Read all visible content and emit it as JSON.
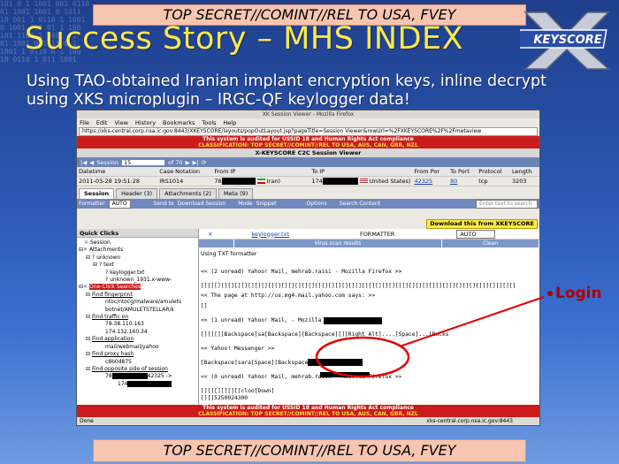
{
  "classification_banner": "TOP SECRET//COMINT//REL TO USA, FVEY",
  "title": "Success Story – MHS INDEX",
  "logo_text": "KEYSCORE",
  "subtitle": "Using TAO-obtained Iranian implant encryption keys, inline decrypt using XKS microplugin – IRGC-QF keylogger data!",
  "annotation_label": "Login",
  "browser": {
    "window_title": "XK Session Viewer - Mozilla Firefox",
    "menu": [
      "File",
      "Edit",
      "View",
      "History",
      "Bookmarks",
      "Tools",
      "Help"
    ],
    "url": "https://xks-central.corp.nsa.ic.gov:8443/XKEYSCORE/layouts/popOutLayout.jsp?pageTitle=Session Viewer&rowUrl=%2FXKEYSCORE%2F%2Fmetaview",
    "audit_line1": "This system is audited for USSID 18 and Human Rights Act compliance",
    "audit_line2": "CLASSIFICATION: TOP SECRET//COMINT//REL TO USA, AUS, CAN, GBR, NZL",
    "viewer_title": "X-KEYSCORE C2C Session Viewer",
    "session_label": "Session",
    "session_value": "15",
    "session_of": "of 70",
    "meta_headers": [
      "Datetime",
      "Case Notation",
      "From IP",
      "To IP",
      "From Por",
      "To Port",
      "Protocol",
      "Length"
    ],
    "meta_row": {
      "datetime": "2011-03-28 19:51:28",
      "case": "IRS1014",
      "from_ip_prefix": "78",
      "from_country": "Iran)",
      "to_ip_prefix": "174",
      "to_country": "United States)",
      "from_port": "42325",
      "to_port": "80",
      "protocol": "tcp",
      "length": "3203"
    },
    "tabs": [
      "Session",
      "Header (3)",
      "Attachments (2)",
      "Meta (9)"
    ],
    "toolbar": {
      "formatter": "Formatter",
      "formatter_value": "AUTO",
      "send_to": "Send to",
      "download_session": "Download Session",
      "mode": "Mode",
      "snippet": "Snippet",
      "options": "Options",
      "search_content": "Search Content",
      "search_placeholder": "Enter text to search"
    },
    "download_button": "Download this from XKEYSCORE",
    "quick_clicks": "Quick Clicks",
    "tree": [
      "Session",
      "Attachments",
      "unknown",
      "text",
      "keylogger.txt",
      "unknown_1931.x-www-",
      "One-Click Searches",
      "Find fingerprint",
      "ntoc/ntocg/malware/amulets",
      "botnet/AMULETSTELLAR/k",
      "Find traffic on",
      "78.38.110.163",
      "174.132.160.34",
      "Find application",
      "mail/webmail/yahoo",
      "Find proxy hash",
      "c8b0d875",
      "Find opposite side of session",
      "78",
      "42325 ->",
      "174"
    ],
    "attachment_name": "keylogger.txt",
    "attachment_formatter": "FORMATTER",
    "attachment_format_value": "AUTO",
    "scan_header": "Virus scan results",
    "scan_result": "Clean",
    "content_lines": [
      "Using TXT formatter",
      "<< (2 unread) Yahoo! Mail, mehrab.raisi - Mozilla Firefox >>",
      "[][][][][][][][][][][][][][][][][][][][][][][][][][][][][][][][][][][][][][][][][][][][][][][]",
      "<< The page at http://us.mg4.mail.yahoo.com says: >>",
      "[]",
      "<< (1 unread) Yahoo! Mail,                - Mozilla Firefox >>",
      "[][][][Backspace]sa[Backspace][Backspace][][Right Alt]....[Space]...[Backs",
      "<< Yahoo! Messenger >>",
      "[Backspace]sara[Space][Backspace",
      "<< (0 unread) Yahoo! Mail, mehrab.raisi - Mozilla Firefox >>",
      "[][][][][][]cloo[Down]",
      "[][]5250024300"
    ],
    "status_left": "Done",
    "status_right": "xks-central.corp.nsa.ic.gov:8443"
  }
}
